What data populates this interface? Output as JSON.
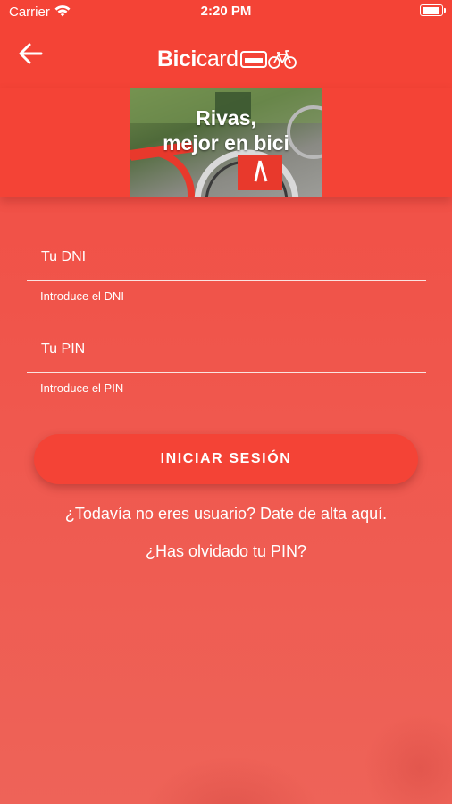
{
  "status_bar": {
    "carrier": "Carrier",
    "time": "2:20 PM",
    "wifi_icon": "wifi-icon",
    "battery_icon": "battery-icon"
  },
  "nav": {
    "back_icon": "arrow-left-icon",
    "brand_bold": "Bici",
    "brand_light": "card",
    "brand_icons": [
      "card-icon",
      "bicycle-icon"
    ]
  },
  "banner": {
    "line1": "Rivas,",
    "line2": "mejor en bici"
  },
  "form": {
    "dni": {
      "placeholder": "Tu DNI",
      "value": "",
      "help": "Introduce el DNI"
    },
    "pin": {
      "placeholder": "Tu PIN",
      "value": "",
      "help": "Introduce el PIN"
    },
    "login_label": "INICIAR SESIÓN"
  },
  "links": {
    "signup": "¿Todavía no eres usuario? Date de alta aquí.",
    "forgot_pin": "¿Has olvidado tu PIN?"
  },
  "colors": {
    "primary": "#f44336",
    "background": "#ef5a50",
    "text": "#ffffff"
  }
}
